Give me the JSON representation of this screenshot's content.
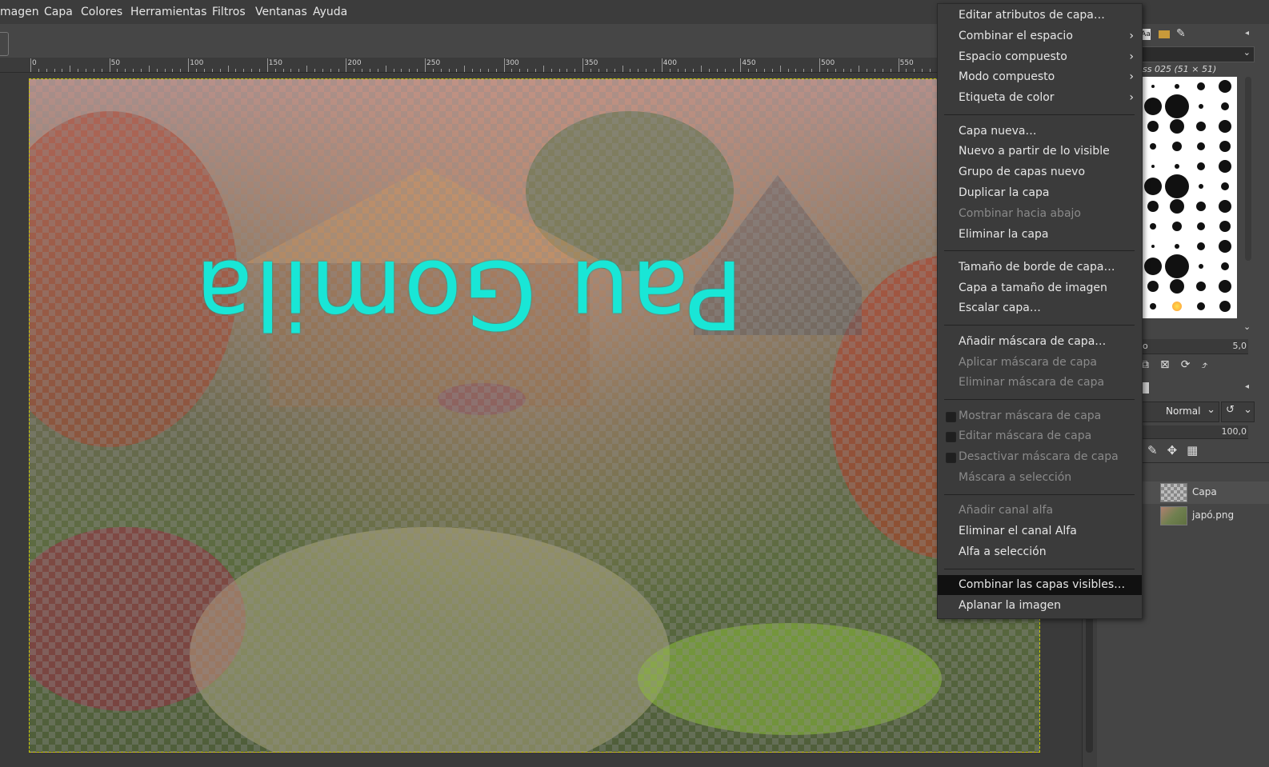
{
  "menubar": {
    "items": [
      "magen",
      "Capa",
      "Colores",
      "Herramientas",
      "Filtros",
      "Ventanas",
      "Ayuda"
    ]
  },
  "ruler": {
    "labels": [
      "0",
      "50",
      "100",
      "150",
      "200",
      "250",
      "300",
      "350",
      "400",
      "450",
      "500",
      "550"
    ]
  },
  "image": {
    "text_layer": "Pau Gomila"
  },
  "context_menu": {
    "items": [
      {
        "label": "Editar atributos de capa…",
        "enabled": true
      },
      {
        "label": "Combinar el espacio",
        "enabled": true,
        "submenu": true
      },
      {
        "label": "Espacio compuesto",
        "enabled": true,
        "submenu": true
      },
      {
        "label": "Modo compuesto",
        "enabled": true,
        "submenu": true
      },
      {
        "label": "Etiqueta de color",
        "enabled": true,
        "submenu": true
      },
      {
        "label": "Capa nueva…",
        "enabled": true
      },
      {
        "label": "Nuevo a partir de lo visible",
        "enabled": true
      },
      {
        "label": "Grupo de capas nuevo",
        "enabled": true
      },
      {
        "label": "Duplicar la capa",
        "enabled": true
      },
      {
        "label": "Combinar hacia abajo",
        "enabled": false
      },
      {
        "label": "Eliminar la capa",
        "enabled": true
      },
      {
        "label": "Tamaño de borde de capa…",
        "enabled": true
      },
      {
        "label": "Capa a tamaño de imagen",
        "enabled": true
      },
      {
        "label": "Escalar capa…",
        "enabled": true
      },
      {
        "label": "Añadir máscara de capa…",
        "enabled": true
      },
      {
        "label": "Aplicar máscara de capa",
        "enabled": false
      },
      {
        "label": "Eliminar máscara de capa",
        "enabled": false
      },
      {
        "label": "Mostrar máscara de capa",
        "enabled": false,
        "checkbox": true
      },
      {
        "label": "Editar máscara de capa",
        "enabled": false,
        "checkbox": true
      },
      {
        "label": "Desactivar máscara de capa",
        "enabled": false,
        "checkbox": true
      },
      {
        "label": "Máscara a selección",
        "enabled": false
      },
      {
        "label": "Añadir canal alfa",
        "enabled": false
      },
      {
        "label": "Eliminar el canal Alfa",
        "enabled": true
      },
      {
        "label": "Alfa a selección",
        "enabled": true
      },
      {
        "label": "Combinar las capas visibles…",
        "enabled": true,
        "highlighted": true
      },
      {
        "label": "Aplanar la imagen",
        "enabled": true
      }
    ]
  },
  "right_panel": {
    "brush_title": "ss 025 (51 × 51)",
    "brush_spacing_value": "5,0",
    "brush_spacing_label": "o",
    "tab_text_label": "Aa",
    "mode": "Normal",
    "opacity": "100,0",
    "layers": [
      {
        "name": "Capa"
      },
      {
        "name": "japó.png"
      }
    ]
  },
  "colors": {
    "text_layer": "#19e6d6",
    "menu_bg": "#3b3b3b",
    "highlight": "#111111"
  }
}
